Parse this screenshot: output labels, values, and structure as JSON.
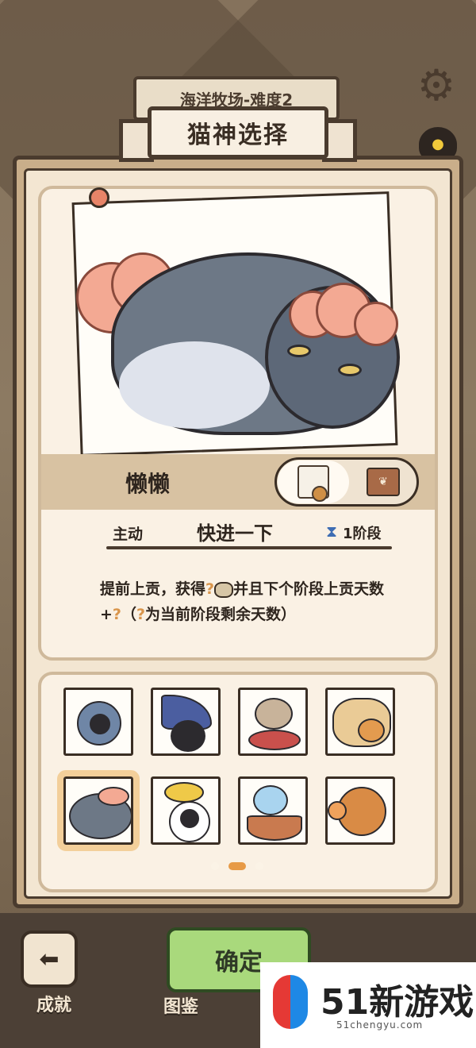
{
  "level_sign": "海洋牧场-难度2",
  "title": "猫神选择",
  "cat": {
    "name": "懒懒",
    "skill_type": "主动",
    "skill_name": "快进一下",
    "skill_phase": "1阶段",
    "desc_part1": "提前上贡，获得",
    "desc_part2": "并且下个阶段上贡天数+",
    "desc_part3": "（",
    "desc_part4": "为当前阶段剩余天数）",
    "q": "?"
  },
  "icons": {
    "settings": "gear-icon",
    "hourglass": "hourglass-icon",
    "certificate": "certificate-icon",
    "outfit": "shirt-icon",
    "achievement": "back-arrow-icon"
  },
  "grid": {
    "selected_index": 4,
    "page_count": 3,
    "active_page": 1
  },
  "bottom": {
    "achievement_label": "成就",
    "book_label": "图鉴",
    "confirm_label": "确定"
  },
  "watermark": {
    "main": "51新游戏",
    "sub": "51chengyu.com"
  },
  "colors": {
    "accent_orange": "#e79a46",
    "confirm_green": "#a9d97c",
    "panel_cream": "#faf1e4",
    "outline": "#3a2e24"
  }
}
